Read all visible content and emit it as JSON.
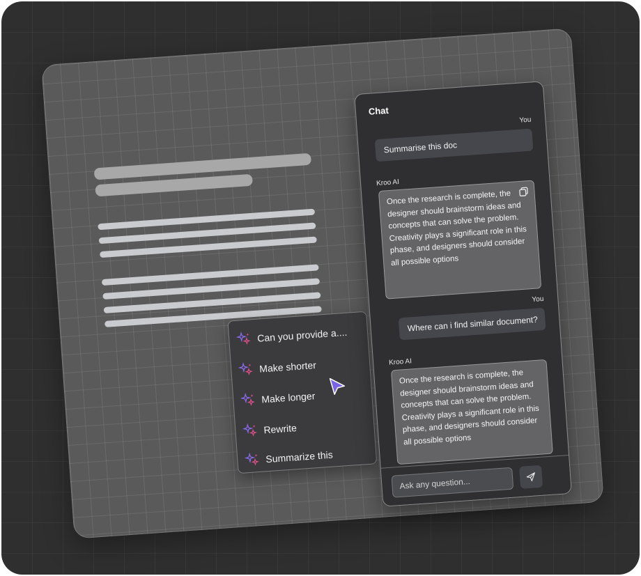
{
  "chat": {
    "title": "Chat",
    "messages": [
      {
        "sender": "You",
        "text": "Summarise this doc"
      },
      {
        "sender": "Kroo AI",
        "text": "Once the research is complete, the designer should brainstorm ideas and concepts that can solve the problem. Creativity plays a significant role in this phase, and designers should consider all possible options"
      },
      {
        "sender": "You",
        "text": "Where can i find similar document?"
      },
      {
        "sender": "Kroo AI",
        "text": "Once the research is complete, the designer should brainstorm ideas and concepts that can solve the problem. Creativity plays a significant role in this phase, and designers should consider all possible options"
      }
    ],
    "input_placeholder": "Ask any question...",
    "copy_icon": "copy-icon",
    "send_icon": "send-icon"
  },
  "suggestions": {
    "items": [
      {
        "label": "Can you provide a....",
        "icon": "sparkle-icon"
      },
      {
        "label": "Make shorter",
        "icon": "sparkle-icon"
      },
      {
        "label": "Make longer",
        "icon": "sparkle-icon"
      },
      {
        "label": "Rewrite",
        "icon": "sparkle-icon"
      },
      {
        "label": "Summarize this",
        "icon": "sparkle-icon"
      }
    ]
  },
  "colors": {
    "background": "#2f2f2f",
    "board": "#5a5a5a",
    "panel": "#2f2f31",
    "sparkle_purple": "#8b6cf0",
    "sparkle_pink": "#e0508a",
    "cursor": "#7a63e6"
  }
}
